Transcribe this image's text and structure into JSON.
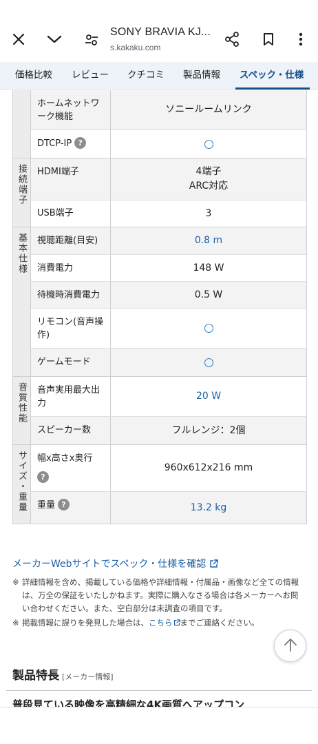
{
  "browser": {
    "title": "SONY BRAVIA KJ...",
    "url": "s.kakaku.com"
  },
  "tabs": [
    {
      "label": "価格比較"
    },
    {
      "label": "レビュー"
    },
    {
      "label": "クチコミ"
    },
    {
      "label": "製品情報"
    },
    {
      "label": "スペック・仕様",
      "active": true
    }
  ],
  "spec": {
    "groups": [
      {
        "label": "",
        "rows": [
          {
            "name": "ホームネットワーク機能",
            "value": "ソニールームリンク"
          },
          {
            "name": "DTCP-IP",
            "help": true,
            "value": "○",
            "mark": "circle"
          }
        ]
      },
      {
        "label": "接続端子",
        "rows": [
          {
            "name": "HDMI端子",
            "value": "4端子\nARC対応"
          },
          {
            "name": "USB端子",
            "value": "3"
          }
        ]
      },
      {
        "label": "基本仕様",
        "rows": [
          {
            "name": "視聴距離(目安)",
            "value": "0.8 m",
            "link": true
          },
          {
            "name": "消費電力",
            "value": "148 W"
          },
          {
            "name": "待機時消費電力",
            "value": "0.5 W"
          },
          {
            "name": "リモコン(音声操作)",
            "value": "○",
            "mark": "circle"
          },
          {
            "name": "ゲームモード",
            "value": "○",
            "mark": "circle"
          }
        ]
      },
      {
        "label": "音質性能",
        "rows": [
          {
            "name": "音声実用最大出力",
            "value": "20 W",
            "link": true
          },
          {
            "name": "スピーカー数",
            "value": "フルレンジ：2個"
          }
        ]
      },
      {
        "label": "サイズ・重量",
        "rows": [
          {
            "name": "幅x高さx奥行",
            "help": true,
            "value": "960x612x216 mm"
          },
          {
            "name": "重量",
            "help": true,
            "value": "13.2 kg",
            "link": true
          }
        ]
      }
    ]
  },
  "maker_link": "メーカーWebサイトでスペック・仕様を確認",
  "notes": {
    "note1_mark": "※",
    "note1": "詳細情報を含め、掲載している価格や詳細情報・付属品・画像など全ての情報は、万全の保証をいたしかねます。実際に購入なさる場合は各メーカーへお問い合わせください。また、空白部分は未調査の項目です。",
    "note2_mark": "※",
    "note2_before": "掲載情報に誤りを発見した場合は、",
    "note2_link": "こちら",
    "note2_after": "までご連絡ください。"
  },
  "features": {
    "title": "製品特長",
    "subtitle": "[メーカー情報]",
    "clipped_heading": "普段見ている映像を高精細な4K画質へアップコン"
  },
  "colors": {
    "link": "#1d5fa5",
    "active_tab": "#1a4f8a",
    "tab_bg": "#edf3f8",
    "group_bg": "#ececec",
    "alt_row_bg": "#f3f3f3"
  }
}
